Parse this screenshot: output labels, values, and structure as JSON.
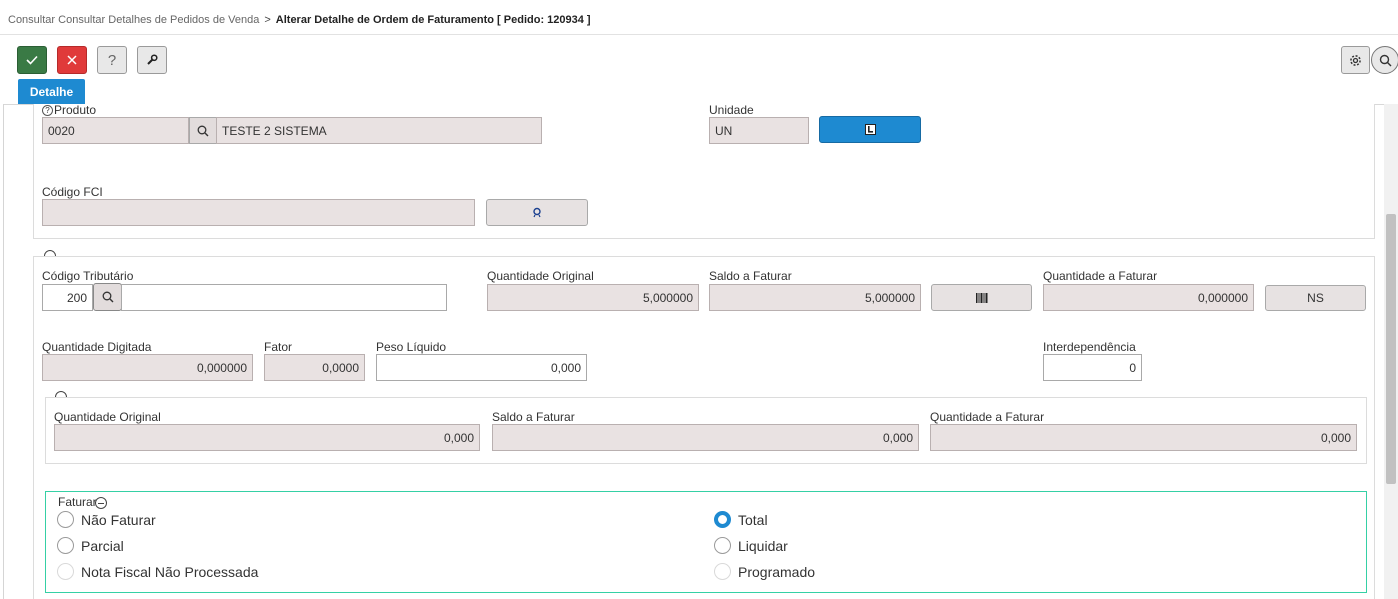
{
  "breadcrumb": {
    "parent": "Consultar Consultar Detalhes de Pedidos de Venda",
    "separator": ">",
    "current": "Alterar Detalhe de Ordem de Faturamento [ Pedido: 120934 ]"
  },
  "toolbar": {
    "confirm_icon": "check-icon",
    "cancel_icon": "close-icon",
    "help_label": "?",
    "tools_icon": "wrench-icon",
    "settings_icon": "gear-icon",
    "search_icon": "search-icon"
  },
  "tabs": [
    {
      "label": "Detalhe",
      "active": true
    }
  ],
  "produto": {
    "help_mark": "?",
    "label": "Produto",
    "code": "0020",
    "description": "TESTE 2 SISTEMA",
    "search_icon": "search-icon"
  },
  "unidade": {
    "label": "Unidade",
    "value": "UN",
    "button_icon": "list-icon"
  },
  "codigo_fci": {
    "label": "Código FCI",
    "value": "",
    "button_icon": "lookup-icon"
  },
  "tributario": {
    "label": "Código Tributário",
    "code": "200",
    "description": ""
  },
  "quantidades": {
    "quantidade_original_label": "Quantidade Original",
    "quantidade_original": "5,000000",
    "saldo_a_faturar_label": "Saldo a Faturar",
    "saldo_a_faturar": "5,000000",
    "barcode_icon": "barcode-icon",
    "quantidade_a_faturar_label": "Quantidade a Faturar",
    "quantidade_a_faturar": "0,000000",
    "ns_label": "NS",
    "quantidade_digitada_label": "Quantidade Digitada",
    "quantidade_digitada": "0,000000",
    "fator_label": "Fator",
    "fator": "0,0000",
    "peso_liquido_label": "Peso Líquido",
    "peso_liquido": "0,000",
    "interdependencia_label": "Interdependência",
    "interdependencia": "0"
  },
  "sub_quantidades": {
    "quantidade_original_label": "Quantidade Original",
    "quantidade_original": "0,000",
    "saldo_a_faturar_label": "Saldo a Faturar",
    "saldo_a_faturar": "0,000",
    "quantidade_a_faturar_label": "Quantidade a Faturar",
    "quantidade_a_faturar": "0,000"
  },
  "faturar": {
    "legend": "Faturar",
    "options_left": [
      {
        "label": "Não Faturar",
        "state": "unchecked"
      },
      {
        "label": "Parcial",
        "state": "unchecked"
      },
      {
        "label": "Nota Fiscal Não Processada",
        "state": "disabled"
      }
    ],
    "options_right": [
      {
        "label": "Total",
        "state": "checked"
      },
      {
        "label": "Liquidar",
        "state": "unchecked"
      },
      {
        "label": "Programado",
        "state": "disabled"
      }
    ]
  },
  "colors": {
    "primary": "#1e8ad1",
    "confirm": "#3a7a45",
    "cancel": "#e03a3a",
    "readonly_field": "#e9e2e2",
    "group_border": "#35d0a5"
  }
}
